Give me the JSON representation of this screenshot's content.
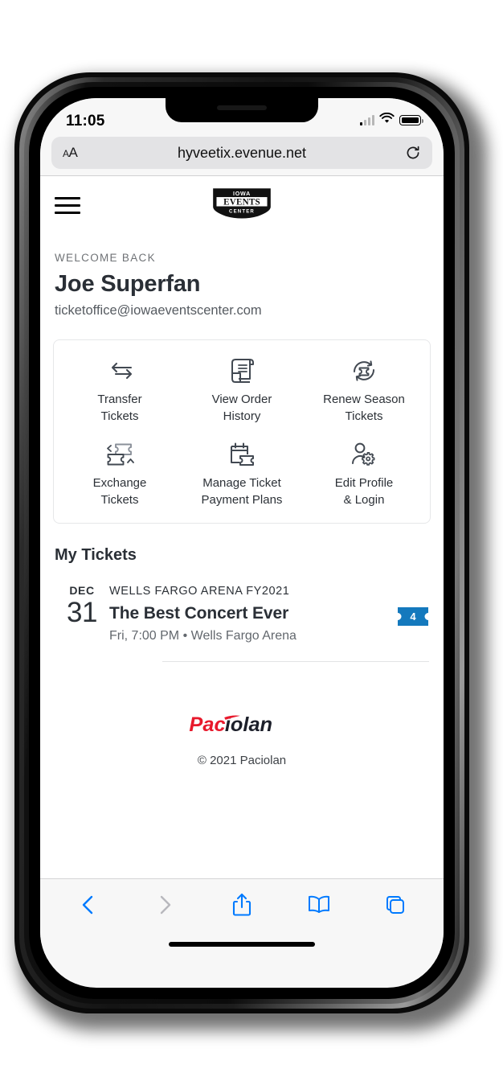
{
  "status_bar": {
    "time": "11:05",
    "signal_icon": "cellular-signal-icon",
    "wifi_icon": "wifi-icon",
    "battery_icon": "battery-icon"
  },
  "browser": {
    "text_size_label": "AA",
    "url": "hyveetix.evenue.net",
    "reload_icon": "reload-icon",
    "toolbar": {
      "back_icon": "back-chevron-icon",
      "forward_icon": "forward-chevron-icon",
      "share_icon": "share-icon",
      "bookmarks_icon": "book-icon",
      "tabs_icon": "tabs-icon"
    },
    "colors": {
      "accent": "#007AFF",
      "disabled": "#b8b8bd"
    }
  },
  "site_header": {
    "menu_icon": "hamburger-menu-icon",
    "logo_alt": "Iowa Events Center",
    "logo_lines": [
      "IOWA",
      "EVENTS",
      "CENTER"
    ]
  },
  "welcome": {
    "label": "WELCOME BACK",
    "name": "Joe Superfan",
    "email": "ticketoffice@iowaeventscenter.com"
  },
  "quick_actions": [
    {
      "icon": "transfer-arrows-icon",
      "label": "Transfer\nTickets",
      "line1": "Transfer",
      "line2": "Tickets"
    },
    {
      "icon": "order-history-scroll-icon",
      "label": "View Order History",
      "line1": "View Order",
      "line2": "History"
    },
    {
      "icon": "renew-ticket-refresh-icon",
      "label": "Renew Season Tickets",
      "line1": "Renew Season",
      "line2": "Tickets"
    },
    {
      "icon": "exchange-tickets-icon",
      "label": "Exchange Tickets",
      "line1": "Exchange",
      "line2": "Tickets"
    },
    {
      "icon": "calendar-ticket-icon",
      "label": "Manage Ticket Payment Plans",
      "line1": "Manage Ticket",
      "line2": "Payment Plans"
    },
    {
      "icon": "person-gear-icon",
      "label": "Edit Profile & Login",
      "line1": "Edit Profile",
      "line2": "& Login"
    }
  ],
  "my_tickets": {
    "title": "My Tickets",
    "events": [
      {
        "month": "DEC",
        "day": "31",
        "series": "WELLS FARGO ARENA FY2021",
        "title": "The Best Concert Ever",
        "meta": "Fri, 7:00 PM • Wells Fargo Arena",
        "qty": "4",
        "qty_badge_color": "#1479bd",
        "qty_badge_icon": "ticket-icon"
      }
    ]
  },
  "footer": {
    "logo_alt": "Paciolan",
    "logo_part_red": "Pac",
    "logo_part_dark": "iolan",
    "copyright": "© 2021 Paciolan",
    "brand_red": "#e8192c",
    "brand_dark": "#1c1f2a"
  }
}
